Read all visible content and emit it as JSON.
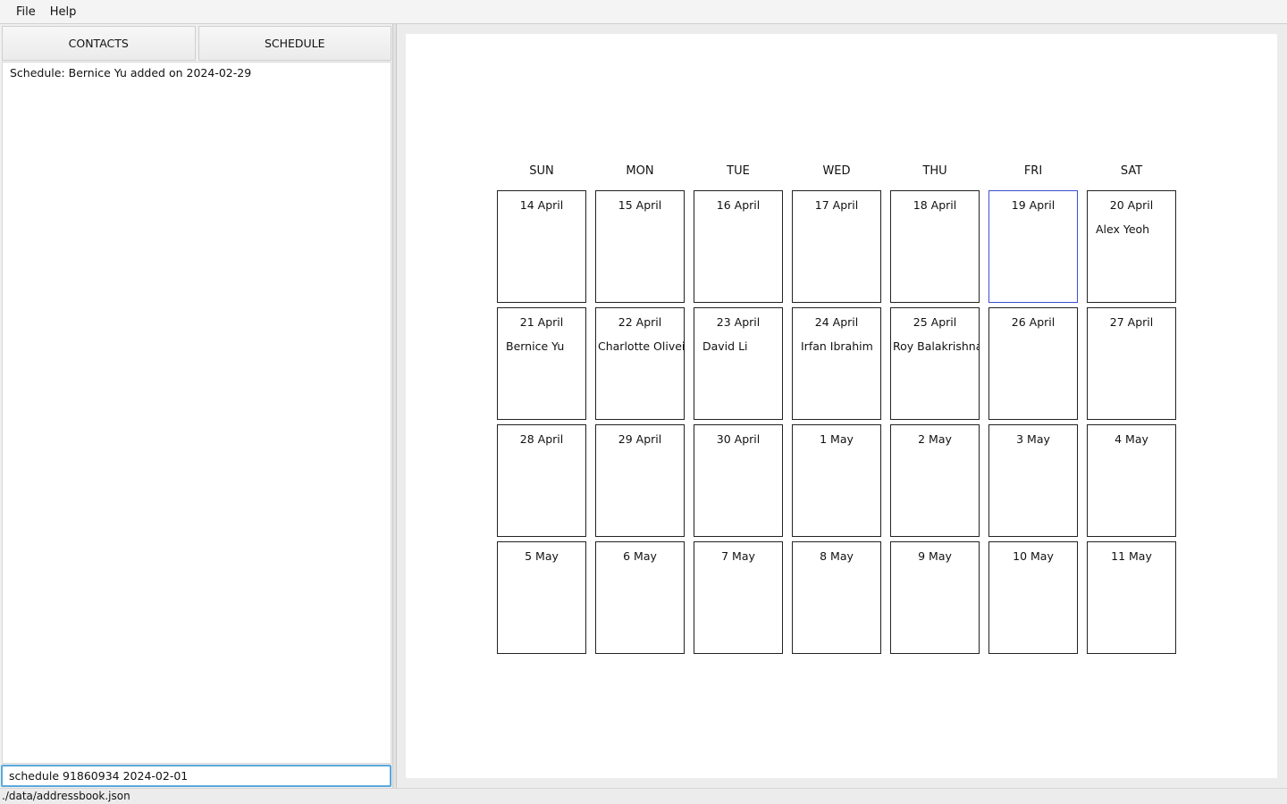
{
  "menu": {
    "items": [
      "File",
      "Help"
    ]
  },
  "tabs": {
    "contacts": "CONTACTS",
    "schedule": "SCHEDULE"
  },
  "result": {
    "text": "Schedule: Bernice Yu added on 2024-02-29"
  },
  "command": {
    "value": "schedule 91860934 2024-02-01"
  },
  "status": {
    "path": "./data/addressbook.json"
  },
  "calendar": {
    "days": [
      "SUN",
      "MON",
      "TUE",
      "WED",
      "THU",
      "FRI",
      "SAT"
    ],
    "today_index": 5,
    "weeks": [
      [
        {
          "date": "14 April",
          "event": ""
        },
        {
          "date": "15 April",
          "event": ""
        },
        {
          "date": "16 April",
          "event": ""
        },
        {
          "date": "17 April",
          "event": ""
        },
        {
          "date": "18 April",
          "event": ""
        },
        {
          "date": "19 April",
          "event": ""
        },
        {
          "date": "20 April",
          "event": "Alex Yeoh"
        }
      ],
      [
        {
          "date": "21 April",
          "event": "Bernice Yu"
        },
        {
          "date": "22 April",
          "event": "Charlotte Oliveiro"
        },
        {
          "date": "23 April",
          "event": "David Li"
        },
        {
          "date": "24 April",
          "event": "Irfan Ibrahim"
        },
        {
          "date": "25 April",
          "event": "Roy Balakrishnan"
        },
        {
          "date": "26 April",
          "event": ""
        },
        {
          "date": "27 April",
          "event": ""
        }
      ],
      [
        {
          "date": "28 April",
          "event": ""
        },
        {
          "date": "29 April",
          "event": ""
        },
        {
          "date": "30 April",
          "event": ""
        },
        {
          "date": "1 May",
          "event": ""
        },
        {
          "date": "2 May",
          "event": ""
        },
        {
          "date": "3 May",
          "event": ""
        },
        {
          "date": "4 May",
          "event": ""
        }
      ],
      [
        {
          "date": "5 May",
          "event": ""
        },
        {
          "date": "6 May",
          "event": ""
        },
        {
          "date": "7 May",
          "event": ""
        },
        {
          "date": "8 May",
          "event": ""
        },
        {
          "date": "9 May",
          "event": ""
        },
        {
          "date": "10 May",
          "event": ""
        },
        {
          "date": "11 May",
          "event": ""
        }
      ]
    ]
  }
}
